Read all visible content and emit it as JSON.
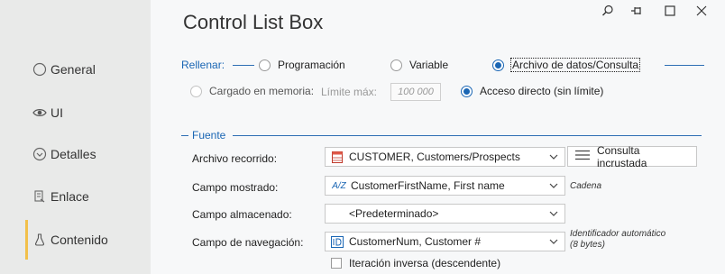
{
  "window": {
    "title": "Control List Box"
  },
  "sidebar": {
    "items": [
      {
        "label": "General",
        "icon": "radio-circle-icon"
      },
      {
        "label": "UI",
        "icon": "eye-icon"
      },
      {
        "label": "Detalles",
        "icon": "chevron-circle-icon"
      },
      {
        "label": "Enlace",
        "icon": "link-doc-icon"
      },
      {
        "label": "Contenido",
        "icon": "flask-icon",
        "active": true
      }
    ],
    "active_color": "#f2c04a"
  },
  "fill": {
    "label": "Rellenar:",
    "options": [
      {
        "label": "Programación",
        "checked": false
      },
      {
        "label": "Variable",
        "checked": false
      },
      {
        "label": "Archivo de datos/Consulta",
        "checked": true
      }
    ]
  },
  "load": {
    "options": [
      {
        "label": "Cargado en memoria:",
        "checked": false
      },
      {
        "label": "Acceso directo (sin límite)",
        "checked": true
      }
    ],
    "max_label": "Límite máx:",
    "max_placeholder": "100 000"
  },
  "source": {
    "section_label": "Fuente",
    "fields": [
      {
        "label": "Archivo recorrido:",
        "value": "CUSTOMER, Customers/Prospects",
        "icon": "table-icon"
      },
      {
        "label": "Campo mostrado:",
        "value": "CustomerFirstName, First name",
        "icon": "az-icon",
        "note": "Cadena"
      },
      {
        "label": "Campo almacenado:",
        "value": "<Predeterminado>",
        "icon": ""
      },
      {
        "label": "Campo de navegación:",
        "value": "CustomerNum, Customer #",
        "icon": "id-icon",
        "note_line1": "Identificador automático",
        "note_line2": "(8 bytes)"
      }
    ],
    "query_button": "Consulta incrustada",
    "reverse_checkbox": "Iteración inversa (descendente)"
  },
  "colors": {
    "accent": "#1a66b4",
    "sidebar_bg": "#e9eae9",
    "main_bg": "#f7f8f9"
  }
}
